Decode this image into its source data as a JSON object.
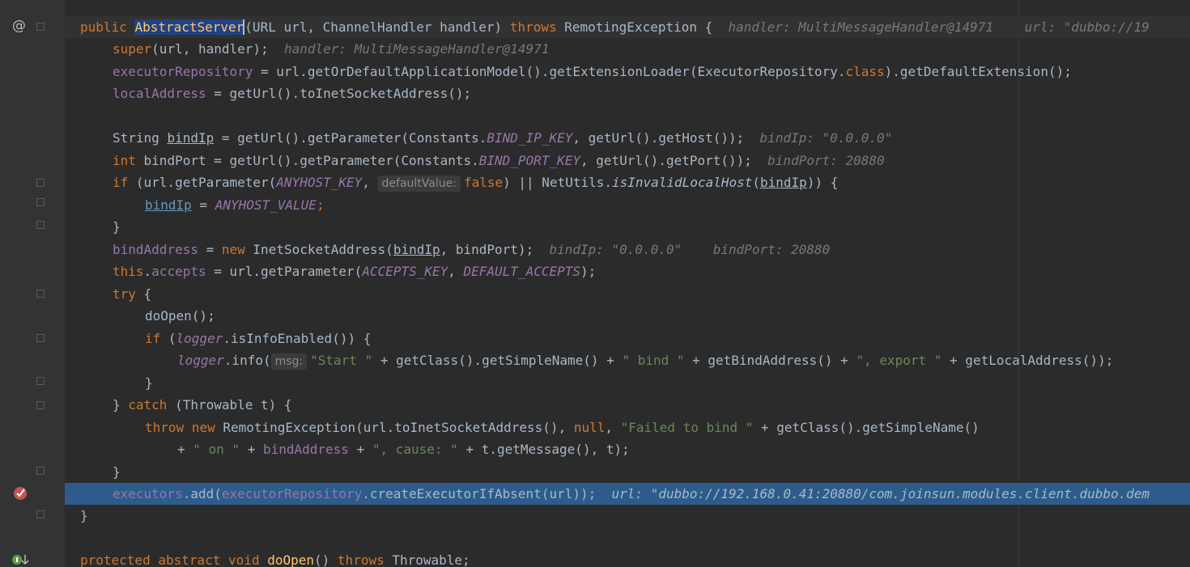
{
  "code": {
    "l1": {
      "kw1": "public",
      "ctor": "AbstractServer",
      "p1": "(URL url, ChannelHandler handler) ",
      "kw2": "throws",
      "p2": " RemotingException {",
      "hint": "handler: MultiMessageHandler@14971    url: \"dubbo://19"
    },
    "l2": {
      "kw": "super",
      "p": "(url, handler);",
      "hint": "handler: MultiMessageHandler@14971"
    },
    "l3": {
      "f1": "executorRepository",
      "p1": " = url.getOrDefaultApplicationModel().getExtensionLoader(ExecutorRepository.",
      "kw": "class",
      "p2": ").getDefaultExtension();"
    },
    "l4": {
      "f": "localAddress",
      "p": " = getUrl().toInetSocketAddress();"
    },
    "l6": {
      "p1": "String ",
      "var": "bindIp",
      "p2": " = getUrl().getParameter(Constants.",
      "c": "BIND_IP_KEY",
      "p3": ", getUrl().getHost());",
      "hint": "bindIp: \"0.0.0.0\""
    },
    "l7": {
      "kw": "int",
      "p1": " bindPort = getUrl().getParameter(Constants.",
      "c": "BIND_PORT_KEY",
      "p2": ", getUrl().getPort());",
      "hint": "bindPort: 20880"
    },
    "l8": {
      "kw": "if",
      "p1": " (url.getParameter(",
      "c": "ANYHOST_KEY",
      "p2": ", ",
      "ph": "defaultValue:",
      "kw2": "false",
      "p3": ") || NetUtils.",
      "m": "isInvalidLocalHost",
      "p4": "(",
      "var": "bindIp",
      "p5": ")) {"
    },
    "l9": {
      "var": "bindIp",
      "p1": " = ",
      "c": "ANYHOST_VALUE",
      "p2": ";"
    },
    "l10": {
      "p": "}"
    },
    "l11": {
      "f": "bindAddress",
      "p1": " = ",
      "kw": "new",
      "p2": " InetSocketAddress(",
      "var": "bindIp",
      "p3": ", bindPort);",
      "hint": "bindIp: \"0.0.0.0\"    bindPort: 20880"
    },
    "l12": {
      "kw": "this",
      "p1": ".",
      "f": "accepts",
      "p2": " = url.getParameter(",
      "c1": "ACCEPTS_KEY",
      "p3": ", ",
      "c2": "DEFAULT_ACCEPTS",
      "p4": ");"
    },
    "l13": {
      "kw": "try",
      "p": " {"
    },
    "l14": {
      "p": "doOpen();"
    },
    "l15": {
      "kw": "if",
      "p1": " (",
      "f": "logger",
      "p2": ".isInfoEnabled()) {"
    },
    "l16": {
      "f": "logger",
      "p1": ".info(",
      "ph": "msg:",
      "s1": "\"Start \"",
      "p2": " + getClass().getSimpleName() + ",
      "s2": "\" bind \"",
      "p3": " + getBindAddress() + ",
      "s3": "\", export \"",
      "p4": " + getLocalAddress());"
    },
    "l17": {
      "p": "}"
    },
    "l18": {
      "p1": "} ",
      "kw": "catch",
      "p2": " (Throwable t) {"
    },
    "l19": {
      "kw1": "throw",
      "kw2": "new",
      "p1": " RemotingException(url.toInetSocketAddress(), ",
      "kw3": "null",
      "p2": ", ",
      "s": "\"Failed to bind \"",
      "p3": " + getClass().getSimpleName()"
    },
    "l20": {
      "p1": "+ ",
      "s1": "\" on \"",
      "p2": " + ",
      "f": "bindAddress",
      "p3": " + ",
      "s2": "\", cause: \"",
      "p4": " + t.getMessage(), t);"
    },
    "l21": {
      "p": "}"
    },
    "l22": {
      "f1": "executors",
      "p1": ".add(",
      "f2": "executorRepository",
      "p2": ".createExecutorIfAbsent(url));",
      "hint": "url: \"dubbo://192.168.0.41:20880/com.joinsun.modules.client.dubbo.dem"
    },
    "l23": {
      "p": "}"
    },
    "l25": {
      "kw1": "protected",
      "kw2": "abstract",
      "kw3": "void",
      "m": "doOpen",
      "p1": "() ",
      "kw4": "throws",
      "p2": " Throwable;"
    }
  },
  "gutter": {
    "override_icon": "@",
    "breakpoint_icon": "breakpoint-check-icon",
    "implement_icon": "implemented-down-icon"
  },
  "colors": {
    "background": "#2b2b2b",
    "keyword": "#cc7832",
    "field": "#9876aa",
    "string": "#6a8759",
    "method": "#ffc66d",
    "execution_line": "#2d5c8c",
    "breakpoint": "#c75450"
  }
}
